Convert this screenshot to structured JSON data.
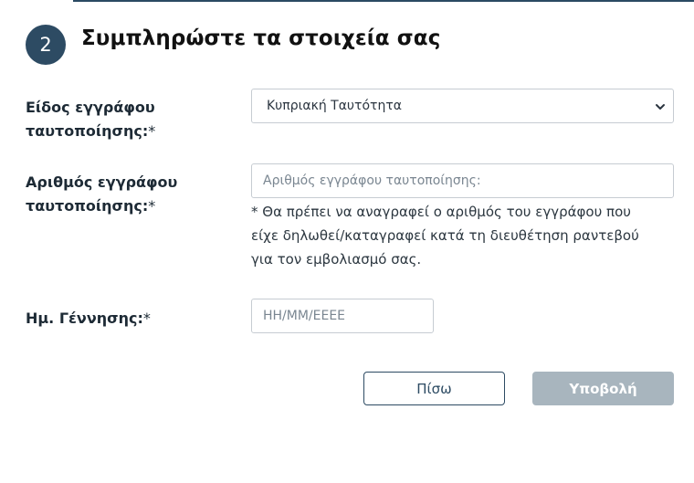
{
  "step": {
    "number": "2",
    "title": "Συμπληρώστε τα στοιχεία σας"
  },
  "form": {
    "doc_type": {
      "label_line1": "Είδος εγγράφου",
      "label_line2": "ταυτοποίησης:",
      "required_mark": "*",
      "selected": "Κυπριακή Ταυτότητα"
    },
    "doc_number": {
      "label_line1": "Αριθμός εγγράφου",
      "label_line2": "ταυτοποίησης:",
      "required_mark": "*",
      "placeholder": "Αριθμός εγγράφου ταυτοποίησης:",
      "hint_line1": "* Θα πρέπει να αναγραφεί ο αριθμός του εγγράφου που",
      "hint_line2": "είχε δηλωθεί/καταγραφεί κατά τη διευθέτηση ραντεβού",
      "hint_line3": "για τον εμβολιασμό σας."
    },
    "birth_date": {
      "label": "Ημ. Γέννησης:",
      "required_mark": "*",
      "placeholder": "ΗΗ/ΜΜ/ΕΕΕΕ"
    }
  },
  "buttons": {
    "back_label": "Πίσω",
    "submit_label": "Υποβολή"
  },
  "colors": {
    "accent": "#2d4b63",
    "submit_disabled": "#a8b5be"
  }
}
